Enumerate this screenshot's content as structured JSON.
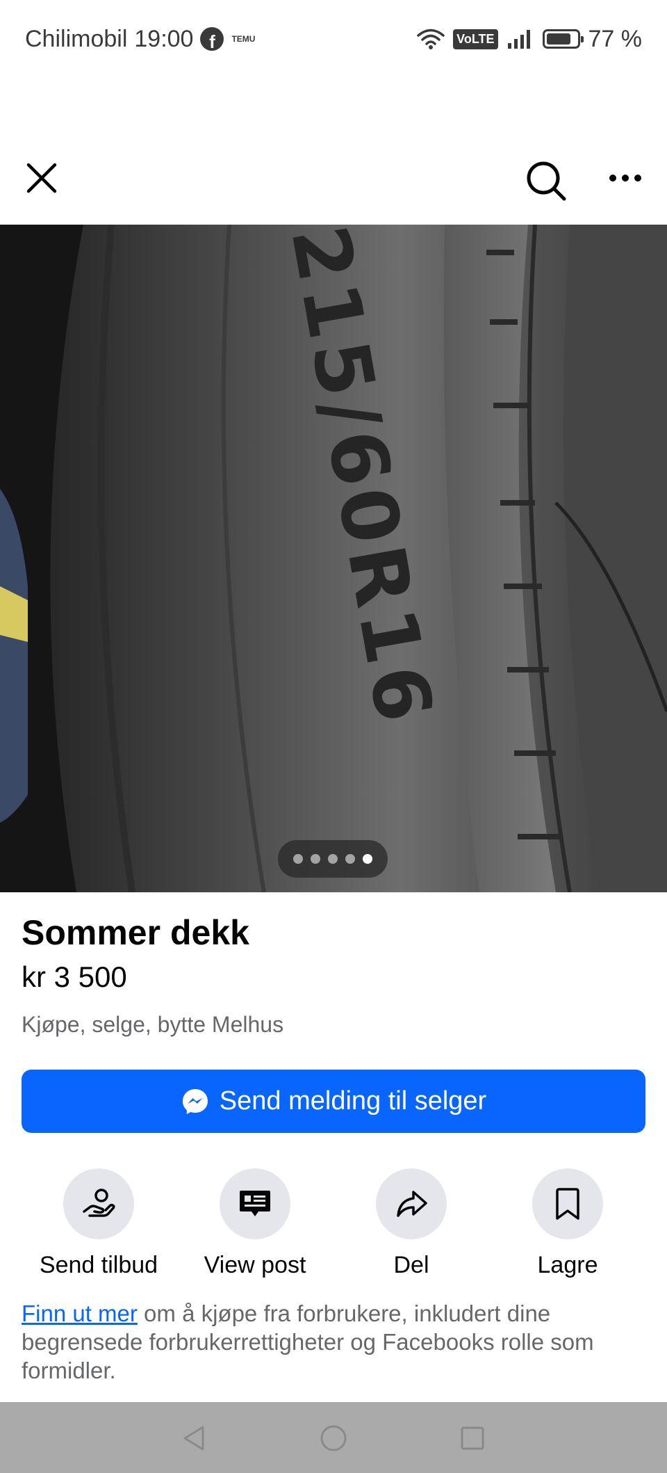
{
  "status_bar": {
    "carrier": "Chilimobil",
    "time": "19:00",
    "temu_label": "TEMU",
    "volte": "VoLTE",
    "battery": "77 %",
    "battery_level": 0.77
  },
  "top_nav": {
    "close_icon": "close-icon",
    "search_icon": "search-icon",
    "more_icon": "more-icon"
  },
  "photo": {
    "tire_marking": "215/60R16",
    "pager": {
      "total": 5,
      "active_index": 4
    }
  },
  "listing": {
    "title": "Sommer dekk",
    "price": "kr 3 500",
    "group": "Kjøpe, selge, bytte Melhus"
  },
  "cta": {
    "label": "Send melding til selger",
    "icon": "messenger-icon",
    "color": "#0866ff"
  },
  "actions": [
    {
      "label": "Send tilbud",
      "icon": "offer-hand-icon"
    },
    {
      "label": "View post",
      "icon": "post-icon"
    },
    {
      "label": "Del",
      "icon": "share-icon"
    },
    {
      "label": "Lagre",
      "icon": "bookmark-icon"
    }
  ],
  "disclaimer": {
    "link": "Finn ut mer",
    "text": " om å kjøpe fra forbrukere, inkludert dine begrensede forbrukerrettigheter og Facebooks rolle som formidler."
  },
  "navbar": {
    "back_icon": "back-triangle-icon",
    "home_icon": "home-circle-icon",
    "recents_icon": "recents-square-icon"
  }
}
